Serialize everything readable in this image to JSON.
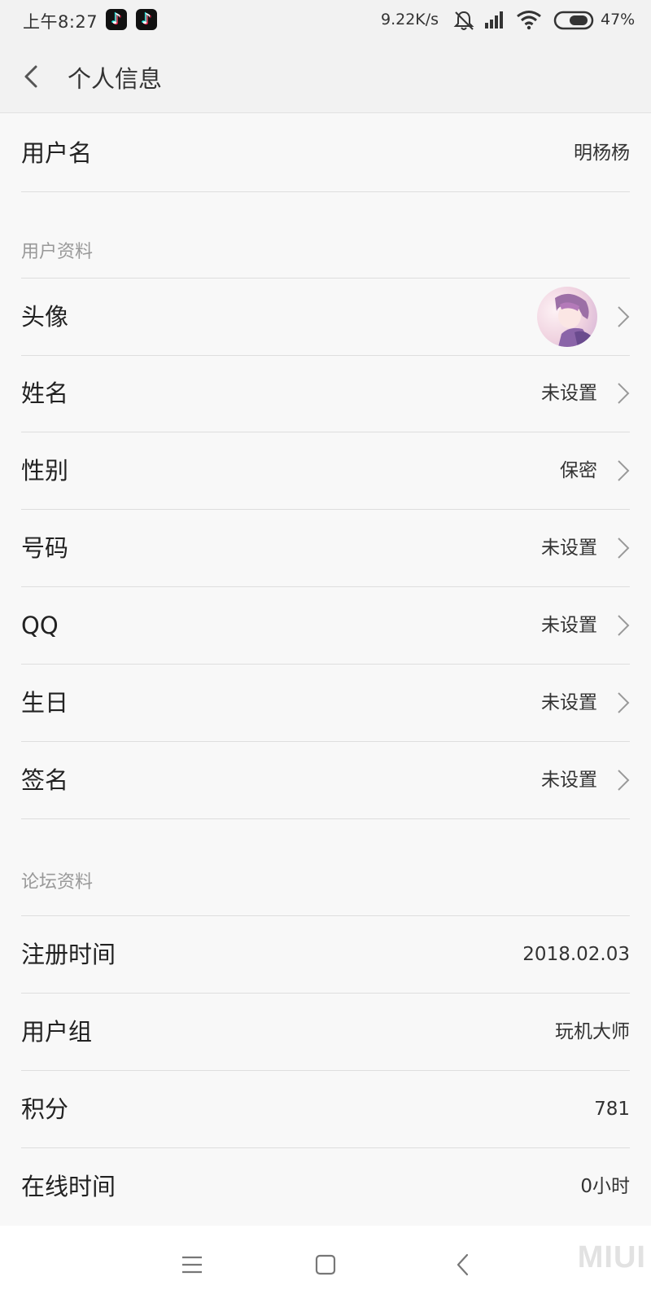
{
  "status_bar": {
    "time": "上午8:27",
    "network_speed": "9.22K/s",
    "battery": "47%",
    "app_icons": [
      "tiktok-icon",
      "tiktok-icon"
    ]
  },
  "header": {
    "title": "个人信息",
    "back_icon": "chevron-left-icon"
  },
  "account": {
    "username_label": "用户名",
    "username_value": "明杨杨"
  },
  "profile_section": {
    "header": "用户资料",
    "avatar_label": "头像",
    "items": [
      {
        "label": "姓名",
        "value": "未设置"
      },
      {
        "label": "性别",
        "value": "保密"
      },
      {
        "label": "号码",
        "value": "未设置"
      },
      {
        "label": "QQ",
        "value": "未设置"
      },
      {
        "label": "生日",
        "value": "未设置"
      },
      {
        "label": "签名",
        "value": "未设置"
      }
    ]
  },
  "forum_section": {
    "header": "论坛资料",
    "items": [
      {
        "label": "注册时间",
        "value": "2018.02.03"
      },
      {
        "label": "用户组",
        "value": "玩机大师"
      },
      {
        "label": "积分",
        "value": "781"
      },
      {
        "label": "在线时间",
        "value": "0小时"
      }
    ]
  },
  "nav_bar": {
    "buttons": [
      "menu-icon",
      "home-icon",
      "back-icon"
    ],
    "watermark": "MIUI"
  },
  "colors": {
    "background": "#f8f8f8",
    "header_background": "#f2f2f2",
    "divider": "#dedede",
    "section_header_text": "#999999",
    "value_text": "#333333"
  }
}
